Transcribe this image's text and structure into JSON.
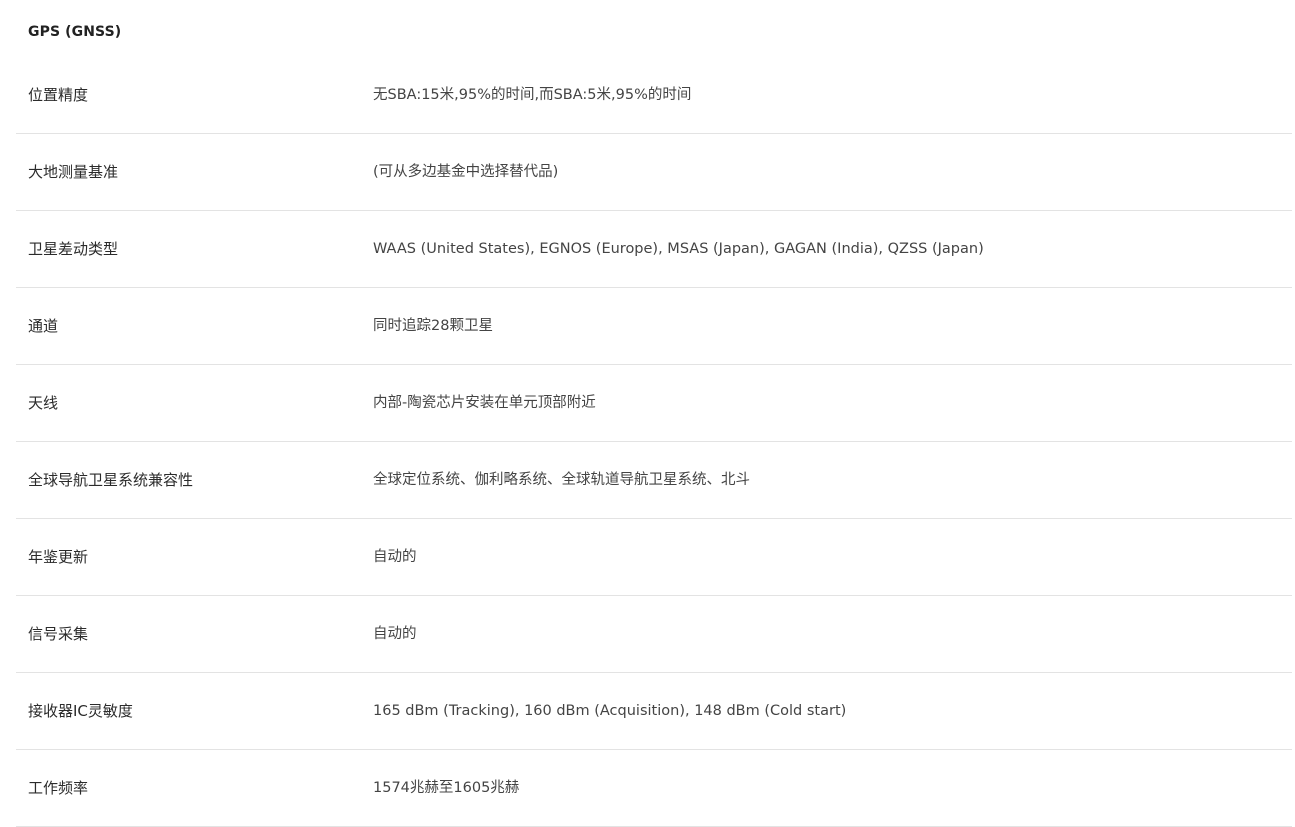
{
  "section": {
    "title": "GPS (GNSS)"
  },
  "rows": [
    {
      "label": "位置精度",
      "value": "无SBA:15米,95%的时间,而SBA:5米,95%的时间"
    },
    {
      "label": "大地测量基准",
      "value": "(可从多边基金中选择替代品)"
    },
    {
      "label": "卫星差动类型",
      "value": "WAAS (United States), EGNOS (Europe), MSAS (Japan), GAGAN (India), QZSS (Japan)"
    },
    {
      "label": "通道",
      "value": "同时追踪28颗卫星"
    },
    {
      "label": "天线",
      "value": "内部-陶瓷芯片安装在单元顶部附近"
    },
    {
      "label": "全球导航卫星系统兼容性",
      "value": "全球定位系统、伽利略系统、全球轨道导航卫星系统、北斗"
    },
    {
      "label": "年鉴更新",
      "value": "自动的"
    },
    {
      "label": "信号采集",
      "value": "自动的"
    },
    {
      "label": "接收器IC灵敏度",
      "value": "165 dBm (Tracking), 160 dBm (Acquisition), 148 dBm (Cold start)"
    },
    {
      "label": "工作频率",
      "value": "1574兆赫至1605兆赫"
    }
  ]
}
